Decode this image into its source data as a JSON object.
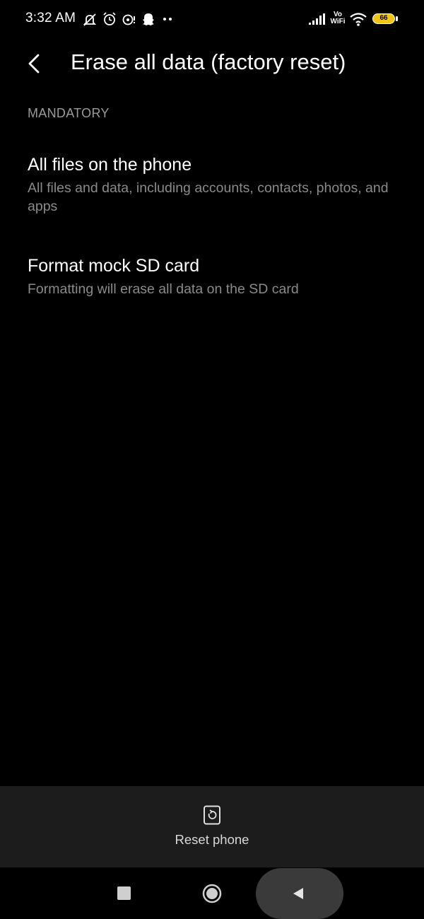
{
  "status_bar": {
    "time": "3:32 AM",
    "vowifi_top": "Vo",
    "vowifi_bottom": "WiFi",
    "battery_level": "66",
    "icons": [
      "mute-icon",
      "alarm-icon",
      "chat-icon",
      "snapchat-icon",
      "more-dots-icon",
      "signal-icon",
      "vowifi-icon",
      "wifi-icon",
      "battery-icon"
    ]
  },
  "header": {
    "title": "Erase all data (factory reset)"
  },
  "section": {
    "header": "MANDATORY"
  },
  "options": [
    {
      "title": "All files on the phone",
      "description": "All files and data, including accounts, contacts, photos, and apps"
    },
    {
      "title": "Format mock SD card",
      "description": "Formatting will erase all data on the SD card"
    }
  ],
  "action": {
    "reset_label": "Reset phone"
  },
  "colors": {
    "background": "#000000",
    "action_bar": "#1c1c1c",
    "secondary_text": "#8a8a8a",
    "battery": "#f0c419"
  }
}
